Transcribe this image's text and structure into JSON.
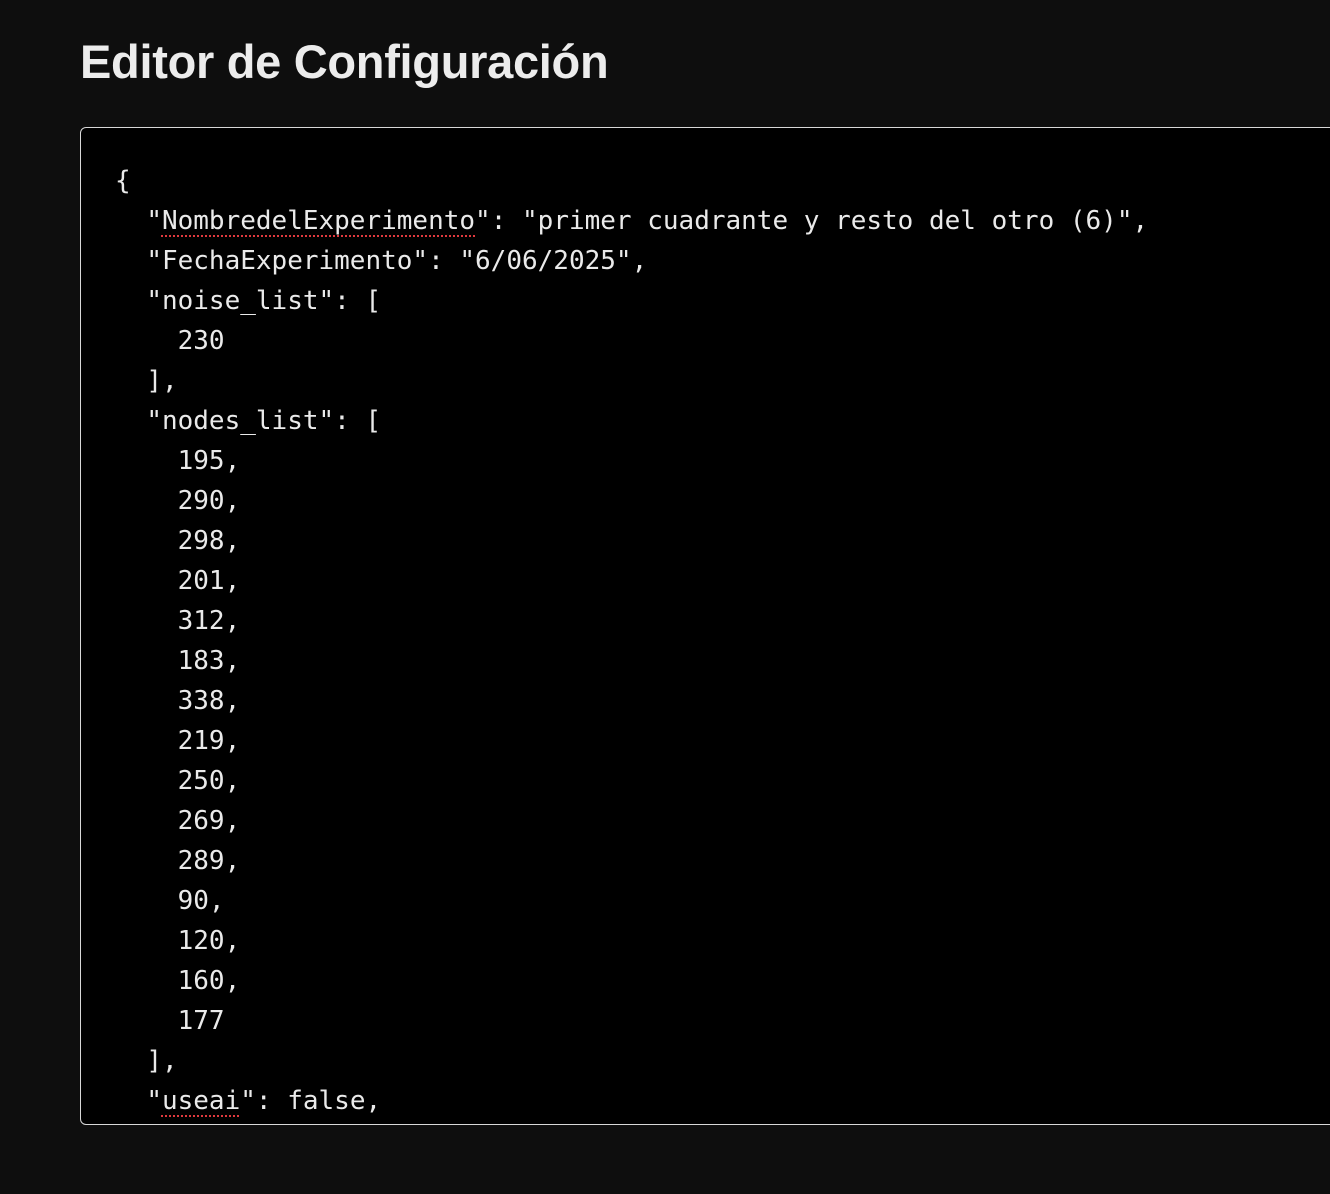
{
  "header": {
    "title": "Editor de Configuración"
  },
  "editor": {
    "lines": [
      {
        "indent": "",
        "pre": "{",
        "spell": "",
        "post": ""
      },
      {
        "indent": "  ",
        "pre": "\"",
        "spell": "NombredelExperimento",
        "post": "\": \"primer cuadrante y resto del otro (6)\","
      },
      {
        "indent": "  ",
        "pre": "\"FechaExperimento\": \"6/06/2025\",",
        "spell": "",
        "post": ""
      },
      {
        "indent": "  ",
        "pre": "\"noise_list\": [",
        "spell": "",
        "post": ""
      },
      {
        "indent": "    ",
        "pre": "230",
        "spell": "",
        "post": ""
      },
      {
        "indent": "  ",
        "pre": "],",
        "spell": "",
        "post": ""
      },
      {
        "indent": "  ",
        "pre": "\"nodes_list\": [",
        "spell": "",
        "post": ""
      },
      {
        "indent": "    ",
        "pre": "195,",
        "spell": "",
        "post": ""
      },
      {
        "indent": "    ",
        "pre": "290,",
        "spell": "",
        "post": ""
      },
      {
        "indent": "    ",
        "pre": "298,",
        "spell": "",
        "post": ""
      },
      {
        "indent": "    ",
        "pre": "201,",
        "spell": "",
        "post": ""
      },
      {
        "indent": "    ",
        "pre": "312,",
        "spell": "",
        "post": ""
      },
      {
        "indent": "    ",
        "pre": "183,",
        "spell": "",
        "post": ""
      },
      {
        "indent": "    ",
        "pre": "338,",
        "spell": "",
        "post": ""
      },
      {
        "indent": "    ",
        "pre": "219,",
        "spell": "",
        "post": ""
      },
      {
        "indent": "    ",
        "pre": "250,",
        "spell": "",
        "post": ""
      },
      {
        "indent": "    ",
        "pre": "269,",
        "spell": "",
        "post": ""
      },
      {
        "indent": "    ",
        "pre": "289,",
        "spell": "",
        "post": ""
      },
      {
        "indent": "    ",
        "pre": "90,",
        "spell": "",
        "post": ""
      },
      {
        "indent": "    ",
        "pre": "120,",
        "spell": "",
        "post": ""
      },
      {
        "indent": "    ",
        "pre": "160,",
        "spell": "",
        "post": ""
      },
      {
        "indent": "    ",
        "pre": "177",
        "spell": "",
        "post": ""
      },
      {
        "indent": "  ",
        "pre": "],",
        "spell": "",
        "post": ""
      },
      {
        "indent": "  ",
        "pre": "\"",
        "spell": "useai",
        "post": "\": false,"
      }
    ]
  }
}
